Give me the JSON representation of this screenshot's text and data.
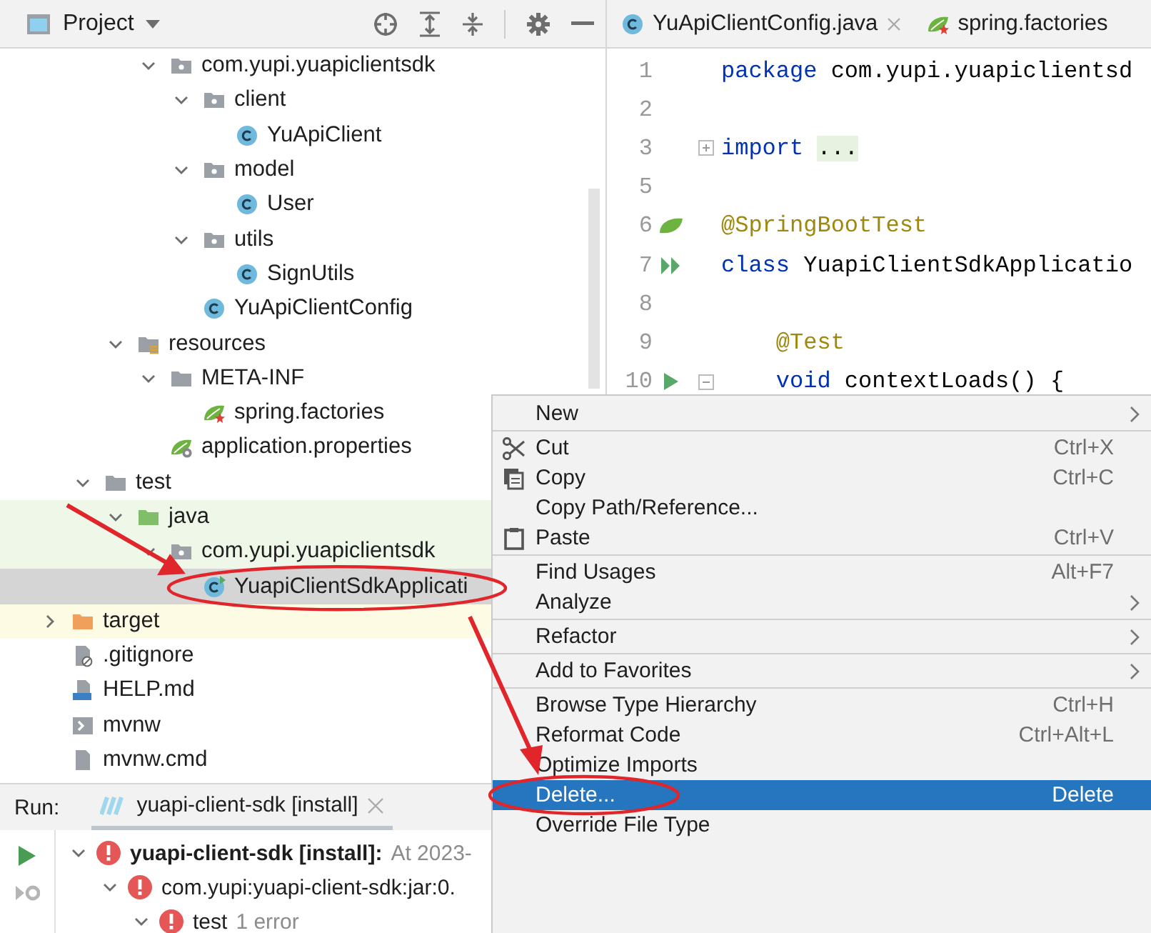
{
  "project_panel": {
    "title": "Project",
    "tree": [
      {
        "label": "com.yupi.yuapiclientsdk",
        "kind": "package",
        "expanded": true,
        "selected": false,
        "children": [
          {
            "label": "client",
            "kind": "package",
            "expanded": true,
            "selected": false,
            "children": [
              {
                "label": "YuApiClient",
                "kind": "class",
                "selected": false
              }
            ]
          },
          {
            "label": "model",
            "kind": "package",
            "expanded": true,
            "selected": false,
            "children": [
              {
                "label": "User",
                "kind": "class",
                "selected": false
              }
            ]
          },
          {
            "label": "utils",
            "kind": "package",
            "expanded": true,
            "selected": false,
            "children": [
              {
                "label": "SignUtils",
                "kind": "class",
                "selected": false
              }
            ]
          },
          {
            "label": "YuApiClientConfig",
            "kind": "class",
            "selected": false
          }
        ]
      },
      {
        "label": "resources",
        "kind": "resources",
        "expanded": true,
        "selected": false,
        "children": [
          {
            "label": "META-INF",
            "kind": "folder",
            "expanded": true,
            "selected": false,
            "children": [
              {
                "label": "spring.factories",
                "kind": "spring",
                "selected": false
              }
            ]
          },
          {
            "label": "application.properties",
            "kind": "properties",
            "selected": false
          }
        ]
      },
      {
        "label": "test",
        "kind": "folder",
        "expanded": true,
        "selected": false,
        "children": [
          {
            "label": "java",
            "kind": "testroot",
            "expanded": true,
            "selected": false,
            "children": [
              {
                "label": "com.yupi.yuapiclientsdk",
                "kind": "package",
                "expanded": true,
                "selected": false,
                "children": [
                  {
                    "label": "YuapiClientSdkApplicati",
                    "kind": "testclass",
                    "selected": true
                  }
                ]
              }
            ]
          }
        ]
      },
      {
        "label": "target",
        "kind": "excluded",
        "expanded": false,
        "selected": false
      },
      {
        "label": ".gitignore",
        "kind": "gitignore",
        "selected": false
      },
      {
        "label": "HELP.md",
        "kind": "markdown",
        "selected": false
      },
      {
        "label": "mvnw",
        "kind": "script",
        "selected": false
      },
      {
        "label": "mvnw.cmd",
        "kind": "cmdfile",
        "selected": false
      }
    ]
  },
  "editor": {
    "tabs": [
      {
        "label": "YuApiClientConfig.java",
        "kind": "class",
        "closable": true
      },
      {
        "label": "spring.factories",
        "kind": "spring",
        "closable": false
      }
    ],
    "lines": [
      {
        "number": "1",
        "kind": "plain",
        "tokens": [
          {
            "text": "package",
            "kind": "keyword"
          },
          {
            "text": " com.yupi.yuapiclientsd",
            "kind": "plain"
          }
        ]
      },
      {
        "number": "2",
        "kind": "plain"
      },
      {
        "number": "3",
        "kind": "fold",
        "tokens": [
          {
            "text": "import",
            "kind": "keyword"
          },
          {
            "text": "...",
            "kind": "folded"
          }
        ]
      },
      {
        "number": "5",
        "kind": "plain"
      },
      {
        "number": "6",
        "kind": "bean",
        "tokens": [
          {
            "text": "@SpringBootTest",
            "kind": "annotation"
          }
        ]
      },
      {
        "number": "7",
        "kind": "runclass",
        "tokens": [
          {
            "text": "class",
            "kind": "keyword"
          },
          {
            "text": " YuapiClientSdkApplicatio",
            "kind": "plain"
          }
        ]
      },
      {
        "number": "8",
        "kind": "plain"
      },
      {
        "number": "9",
        "kind": "plain",
        "tokens": [
          {
            "text": "    @Test",
            "kind": "annotation"
          }
        ]
      },
      {
        "number": "10",
        "kind": "runmethod",
        "tokens": [
          {
            "text": "    void",
            "kind": "keyword"
          },
          {
            "text": " contextLoads() {",
            "kind": "plain"
          }
        ]
      }
    ]
  },
  "run_panel": {
    "label": "Run:",
    "tab": {
      "label": "yuapi-client-sdk [install]",
      "closable": true
    },
    "tree": [
      {
        "label": "yuapi-client-sdk [install]:",
        "detail": "At 2023-",
        "failed": true,
        "expanded": true,
        "children": [
          {
            "label": "com.yupi:yuapi-client-sdk:jar:0.",
            "failed": true,
            "expanded": true,
            "children": [
              {
                "label": "test",
                "detail": "1 error",
                "failed": true,
                "expanded": true
              }
            ]
          }
        ]
      }
    ]
  },
  "context_menu": {
    "groups": [
      [
        {
          "label": "New",
          "has_submenu": true,
          "selected": false
        }
      ],
      [
        {
          "label": "Cut",
          "shortcut": "Ctrl+X",
          "has_submenu": false,
          "selected": false
        },
        {
          "label": "Copy",
          "shortcut": "Ctrl+C",
          "has_submenu": false,
          "selected": false
        },
        {
          "label": "Copy Path/Reference...",
          "has_submenu": false,
          "selected": false
        },
        {
          "label": "Paste",
          "shortcut": "Ctrl+V",
          "has_submenu": false,
          "selected": false
        }
      ],
      [
        {
          "label": "Find Usages",
          "shortcut": "Alt+F7",
          "has_submenu": false,
          "selected": false
        },
        {
          "label": "Analyze",
          "has_submenu": true,
          "selected": false
        }
      ],
      [
        {
          "label": "Refactor",
          "has_submenu": true,
          "selected": false
        }
      ],
      [
        {
          "label": "Add to Favorites",
          "has_submenu": true,
          "selected": false
        }
      ],
      [
        {
          "label": "Browse Type Hierarchy",
          "shortcut": "Ctrl+H",
          "has_submenu": false,
          "selected": false
        },
        {
          "label": "Reformat Code",
          "shortcut": "Ctrl+Alt+L",
          "has_submenu": false,
          "selected": false
        },
        {
          "label": "Optimize Imports",
          "has_submenu": false,
          "selected": false
        },
        {
          "label": "Delete...",
          "shortcut": "Delete",
          "has_submenu": false,
          "selected": true
        },
        {
          "label": "Override File Type",
          "has_submenu": false,
          "selected": false
        }
      ]
    ]
  }
}
